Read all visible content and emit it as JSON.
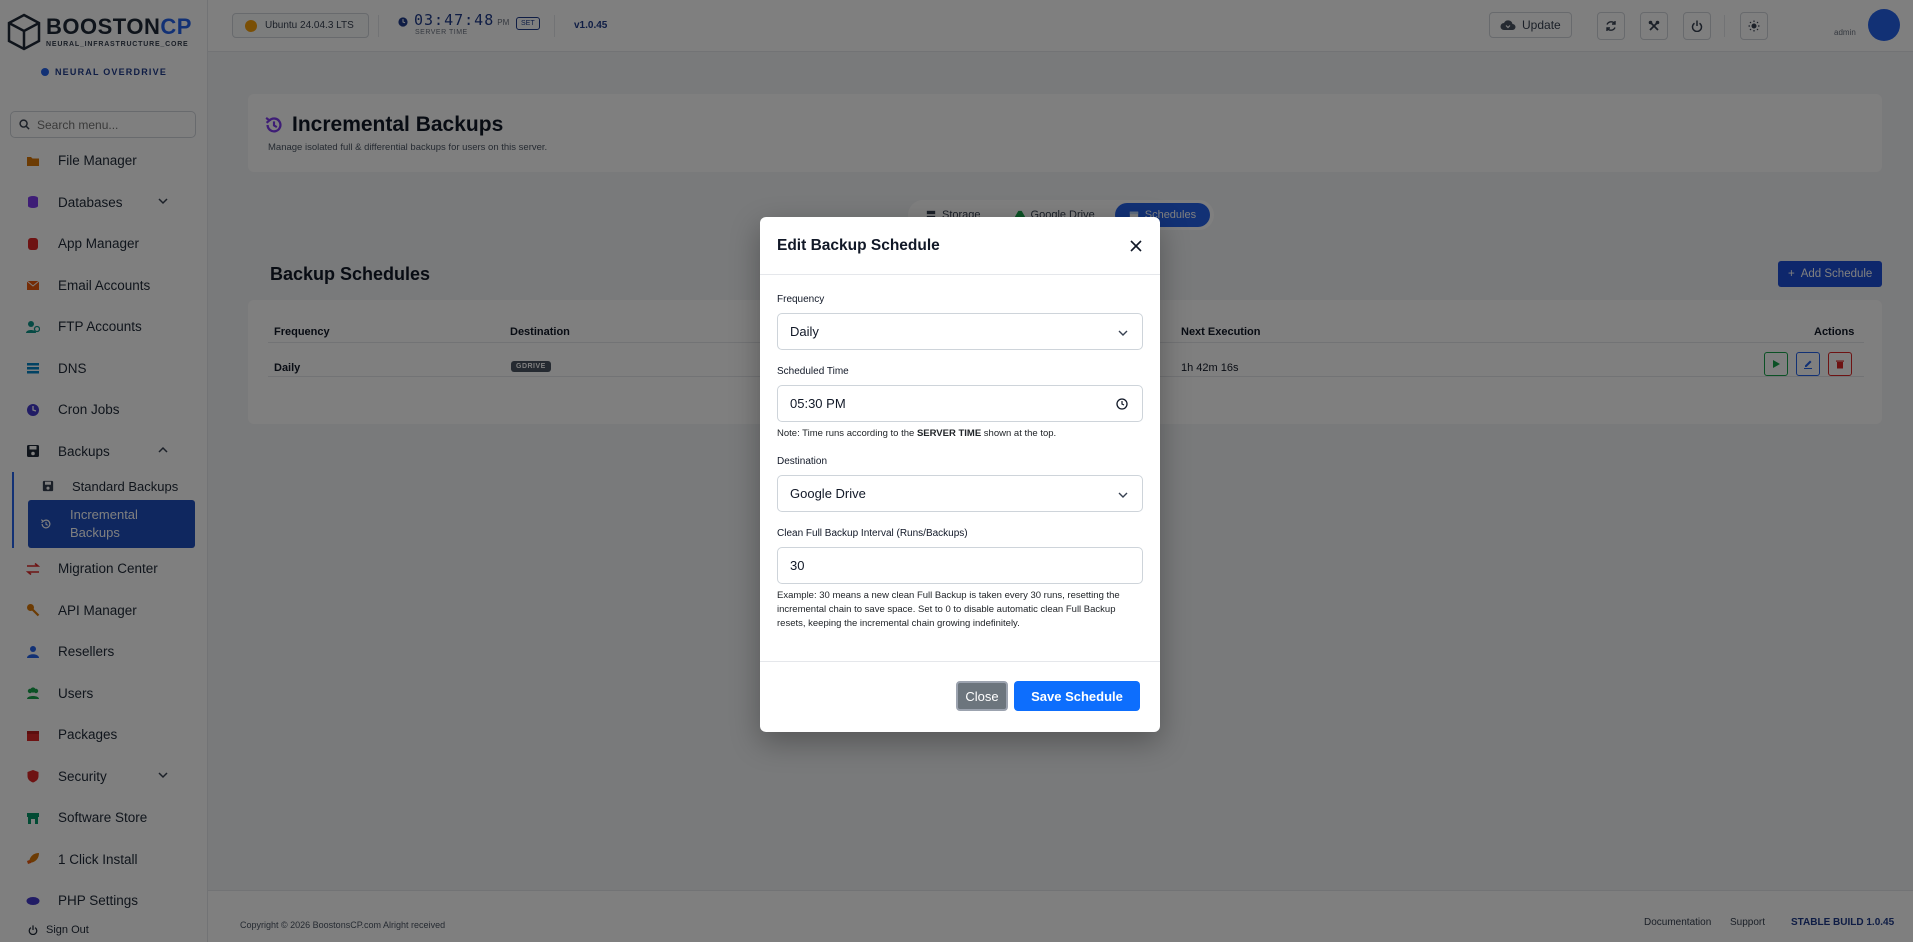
{
  "brand": {
    "name_main": "BOOSTON",
    "name_accent": "CP",
    "tagline": "NEURAL_INFRASTRUCTURE_CORE",
    "mode": "NEURAL OVERDRIVE"
  },
  "sidebar": {
    "search_placeholder": "Search menu...",
    "items": [
      {
        "label": "File Manager",
        "icon": "folder-icon",
        "color": "#d97706"
      },
      {
        "label": "Databases",
        "icon": "database-icon",
        "color": "#7c3aed",
        "chevron": "down"
      },
      {
        "label": "App Manager",
        "icon": "app-icon",
        "color": "#dc2626"
      },
      {
        "label": "Email Accounts",
        "icon": "envelope-icon",
        "color": "#ea580c"
      },
      {
        "label": "FTP Accounts",
        "icon": "ftp-user-icon",
        "color": "#0d9488"
      },
      {
        "label": "DNS",
        "icon": "list-icon",
        "color": "#0284c7"
      },
      {
        "label": "Cron Jobs",
        "icon": "clock-icon",
        "color": "#4338ca"
      },
      {
        "label": "Backups",
        "icon": "save-icon",
        "color": "#1f2937",
        "chevron": "up"
      }
    ],
    "backup_subitems": [
      {
        "label": "Standard Backups",
        "icon": "save-icon"
      },
      {
        "label": "Incremental Backups",
        "icon": "history-icon",
        "active": true
      }
    ],
    "items_after": [
      {
        "label": "Migration Center",
        "icon": "exchange-icon",
        "color": "#dc2626"
      },
      {
        "label": "API Manager",
        "icon": "key-icon",
        "color": "#d97706"
      },
      {
        "label": "Resellers",
        "icon": "user-tie-icon",
        "color": "#2563eb"
      },
      {
        "label": "Users",
        "icon": "users-icon",
        "color": "#16a34a"
      },
      {
        "label": "Packages",
        "icon": "box-icon",
        "color": "#dc2626"
      },
      {
        "label": "Security",
        "icon": "shield-icon",
        "color": "#dc2626",
        "chevron": "down"
      },
      {
        "label": "Software Store",
        "icon": "store-icon",
        "color": "#059669"
      },
      {
        "label": "1 Click Install",
        "icon": "rocket-icon",
        "color": "#d97706"
      },
      {
        "label": "PHP Settings",
        "icon": "php-icon",
        "color": "#4338ca"
      }
    ],
    "sign_out": "Sign Out"
  },
  "topbar": {
    "os": "Ubuntu 24.04.3 LTS",
    "time": "03:47:48",
    "ampm": "PM",
    "time_label": "SERVER TIME",
    "tz": "SET",
    "version": "v1.0.45",
    "update_label": "Update",
    "user": "admin"
  },
  "page": {
    "title": "Incremental Backups",
    "subtitle": "Manage isolated full & differential backups for users on this server.",
    "tabs": [
      "Storage",
      "Google Drive",
      "Schedules"
    ],
    "schedules_title": "Backup Schedules",
    "add_schedule": "Add Schedule",
    "table": {
      "headers": [
        "Frequency",
        "Destination",
        "Next Execution",
        "Actions"
      ],
      "rows": [
        {
          "frequency": "Daily",
          "destination": "GDRIVE",
          "next": "1h 42m 16s"
        }
      ]
    }
  },
  "footer": {
    "copyright": "Copyright © 2026 BoostonsCP.com Alright received",
    "documentation": "Documentation",
    "support": "Support",
    "build": "STABLE BUILD 1.0.45"
  },
  "modal": {
    "title": "Edit Backup Schedule",
    "frequency_label": "Frequency",
    "frequency_value": "Daily",
    "time_label": "Scheduled Time",
    "time_value": "05:30 PM",
    "time_note_pre": "Note: Time runs according to the ",
    "time_note_bold": "SERVER TIME",
    "time_note_post": " shown at the top.",
    "destination_label": "Destination",
    "destination_value": "Google Drive",
    "interval_label": "Clean Full Backup Interval (Runs/Backups)",
    "interval_value": "30",
    "interval_note": "Example: 30 means a new clean Full Backup is taken every 30 runs, resetting the incremental chain to save space. Set to 0 to disable automatic clean Full Backup resets, keeping the incremental chain growing indefinitely.",
    "close_label": "Close",
    "save_label": "Save Schedule"
  }
}
